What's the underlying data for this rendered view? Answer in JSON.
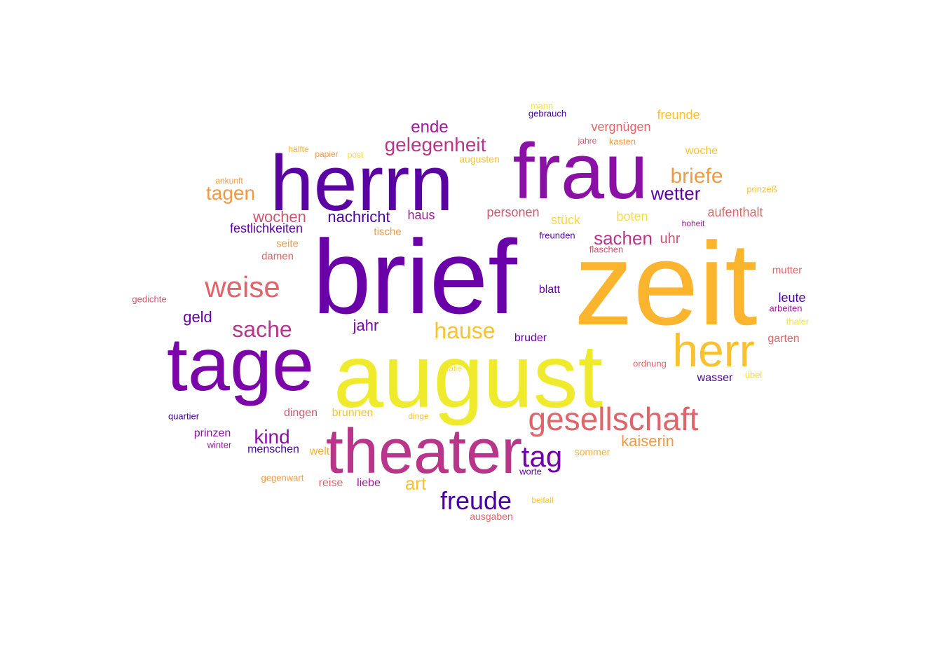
{
  "words": [
    {
      "text": "brief",
      "color": "#6a00a8",
      "weight": 150
    },
    {
      "text": "zeit",
      "color": "#fbb42e",
      "weight": 168
    },
    {
      "text": "august",
      "color": "#f0ea2c",
      "weight": 128
    },
    {
      "text": "herrn",
      "color": "#5b02a3",
      "weight": 112
    },
    {
      "text": "frau",
      "color": "#8a10a6",
      "weight": 112
    },
    {
      "text": "tage",
      "color": "#7b05a8",
      "weight": 108
    },
    {
      "text": "theater",
      "color": "#b8358a",
      "weight": 90
    },
    {
      "text": "herr",
      "color": "#f7c232",
      "weight": 66
    },
    {
      "text": "gesellschaft",
      "color": "#e0656a",
      "weight": 46
    },
    {
      "text": "weise",
      "color": "#e0656a",
      "weight": 42
    },
    {
      "text": "tag",
      "color": "#7001a8",
      "weight": 42
    },
    {
      "text": "freude",
      "color": "#4a029f",
      "weight": 36
    },
    {
      "text": "sache",
      "color": "#b8358a",
      "weight": 32
    },
    {
      "text": "hause",
      "color": "#f8c232",
      "weight": 32
    },
    {
      "text": "briefe",
      "color": "#f09a46",
      "weight": 30
    },
    {
      "text": "gelegenheit",
      "color": "#b8358a",
      "weight": 28
    },
    {
      "text": "tagen",
      "color": "#f09a46",
      "weight": 28
    },
    {
      "text": "kind",
      "color": "#8a10a6",
      "weight": 28
    },
    {
      "text": "wetter",
      "color": "#5b02a3",
      "weight": 26
    },
    {
      "text": "sachen",
      "color": "#b8358a",
      "weight": 26
    },
    {
      "text": "art",
      "color": "#f8c232",
      "weight": 26
    },
    {
      "text": "ende",
      "color": "#9e1a9c",
      "weight": 24
    },
    {
      "text": "wochen",
      "color": "#d0566f",
      "weight": 22
    },
    {
      "text": "nachricht",
      "color": "#4a029f",
      "weight": 22
    },
    {
      "text": "jahr",
      "color": "#7b05a8",
      "weight": 22
    },
    {
      "text": "geld",
      "color": "#6a00a8",
      "weight": 22
    },
    {
      "text": "kaiserin",
      "color": "#f09a46",
      "weight": 22
    },
    {
      "text": "vergnügen",
      "color": "#e0656a",
      "weight": 18
    },
    {
      "text": "freunde",
      "color": "#f8c232",
      "weight": 18
    },
    {
      "text": "personen",
      "color": "#d0566f",
      "weight": 18
    },
    {
      "text": "stück",
      "color": "#f8d83a",
      "weight": 18
    },
    {
      "text": "boten",
      "color": "#f8e03a",
      "weight": 18
    },
    {
      "text": "aufenthalt",
      "color": "#e0656a",
      "weight": 18
    },
    {
      "text": "festlichkeiten",
      "color": "#5b02a3",
      "weight": 18
    },
    {
      "text": "haus",
      "color": "#9e1a9c",
      "weight": 18
    },
    {
      "text": "uhr",
      "color": "#d0566f",
      "weight": 20
    },
    {
      "text": "leute",
      "color": "#4a029f",
      "weight": 18
    },
    {
      "text": "bruder",
      "color": "#6a00a8",
      "weight": 16
    },
    {
      "text": "garten",
      "color": "#e0656a",
      "weight": 16
    },
    {
      "text": "wasser",
      "color": "#4a029f",
      "weight": 16
    },
    {
      "text": "dingen",
      "color": "#d0566f",
      "weight": 16
    },
    {
      "text": "brunnen",
      "color": "#f8c232",
      "weight": 16
    },
    {
      "text": "prinzen",
      "color": "#8a10a6",
      "weight": 16
    },
    {
      "text": "menschen",
      "color": "#4a029f",
      "weight": 16
    },
    {
      "text": "welt",
      "color": "#f8b032",
      "weight": 16
    },
    {
      "text": "reise",
      "color": "#e0656a",
      "weight": 16
    },
    {
      "text": "liebe",
      "color": "#9e1a9c",
      "weight": 16
    },
    {
      "text": "woche",
      "color": "#f8c232",
      "weight": 16
    },
    {
      "text": "blatt",
      "color": "#6a00a8",
      "weight": 16
    },
    {
      "text": "mutter",
      "color": "#e0656a",
      "weight": 15
    },
    {
      "text": "seite",
      "color": "#f09a46",
      "weight": 15
    },
    {
      "text": "damen",
      "color": "#e0656a",
      "weight": 15
    },
    {
      "text": "tische",
      "color": "#f09a46",
      "weight": 15
    },
    {
      "text": "sommer",
      "color": "#f8b032",
      "weight": 14
    },
    {
      "text": "augusten",
      "color": "#f8c232",
      "weight": 14
    },
    {
      "text": "kasten",
      "color": "#f09a46",
      "weight": 13
    },
    {
      "text": "prinzeß",
      "color": "#f8c232",
      "weight": 13
    },
    {
      "text": "flaschen",
      "color": "#d0566f",
      "weight": 13
    },
    {
      "text": "freunden",
      "color": "#5b02a3",
      "weight": 13
    },
    {
      "text": "arbeiten",
      "color": "#9e1a9c",
      "weight": 13
    },
    {
      "text": "thaler",
      "color": "#f8e03a",
      "weight": 13
    },
    {
      "text": "ordnung",
      "color": "#e0656a",
      "weight": 13
    },
    {
      "text": "übel",
      "color": "#f8d83a",
      "weight": 13
    },
    {
      "text": "quartier",
      "color": "#4a029f",
      "weight": 13
    },
    {
      "text": "winter",
      "color": "#9e1a9c",
      "weight": 13
    },
    {
      "text": "worte",
      "color": "#5b02a3",
      "weight": 13
    },
    {
      "text": "gegenwart",
      "color": "#f09a46",
      "weight": 13
    },
    {
      "text": "ausgaben",
      "color": "#e0656a",
      "weight": 14
    },
    {
      "text": "beifall",
      "color": "#f8c232",
      "weight": 12
    },
    {
      "text": "gedichte",
      "color": "#d0566f",
      "weight": 13
    },
    {
      "text": "mann",
      "color": "#f8e03a",
      "weight": 13
    },
    {
      "text": "gebrauch",
      "color": "#4a029f",
      "weight": 13
    },
    {
      "text": "jahre",
      "color": "#d0566f",
      "weight": 12
    },
    {
      "text": "hälfte",
      "color": "#f8b032",
      "weight": 12
    },
    {
      "text": "papier",
      "color": "#f09a46",
      "weight": 12
    },
    {
      "text": "post",
      "color": "#f8d83a",
      "weight": 12
    },
    {
      "text": "ankunft",
      "color": "#f09a46",
      "weight": 12
    },
    {
      "text": "hoheit",
      "color": "#9e1a9c",
      "weight": 12
    },
    {
      "text": "fälle",
      "color": "#f8e03a",
      "weight": 12
    },
    {
      "text": "dinge",
      "color": "#f8c232",
      "weight": 12
    }
  ]
}
